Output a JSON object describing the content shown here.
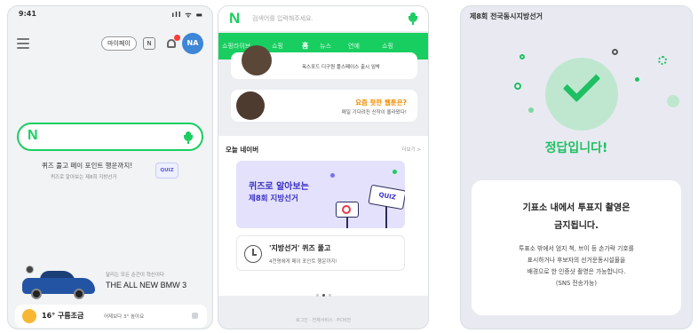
{
  "phone1": {
    "status_time": "9:41",
    "status_icons": "ıll ᯤ ▬",
    "header_pill": "마이페이",
    "header_square": "N",
    "avatar_initials": "NA",
    "search_logo": "N",
    "quiz_text": "퀴즈 풀고 페이 포인트 행운까지!",
    "quiz_subtext": "퀴즈로 알아보는 제8회 지방선거",
    "quiz_badge": "QUIZ",
    "ad_small": "달리는 모든 순간이 혁신이다",
    "ad_title": "THE ALL NEW BMW 3",
    "weather_temp": "16° 구름조금",
    "weather_sub": "어제보다 3° 높아요"
  },
  "phone2": {
    "logo": "N",
    "search_placeholder": "검색어를 입력해주세요.",
    "tabs": [
      "쇼핑라이브",
      "쇼핑",
      "홈",
      "뉴스",
      "연예",
      "쇼핑"
    ],
    "card1_text": "옥스포드 디구원 플스페이스 출시 임박",
    "card2_title": "요즘 핫한 웹툰은?",
    "card2_sub": "매일 기다려진 신작이 올라왔다!",
    "today_label": "오늘 네이버",
    "more_label": "더보기 >",
    "banner_line1": "퀴즈로 알아보는",
    "banner_line2": "제8회 지방선거",
    "banner_sign": "QUIZ",
    "quiz_item_title": "'지방선거' 퀴즈 풀고",
    "quiz_item_sub": "4천명에게 페이 포인트 행운까지!",
    "footer": "로그인 · 전체서비스 · PC버전"
  },
  "phone3": {
    "title": "제8회 전국동시지방선거",
    "correct": "정답입니다!",
    "info_title1": "기표소 내에서 투표지 촬영은",
    "info_title2": "금지됩니다.",
    "info_desc1": "투표소 밖에서 엄지 척, 브이 등 손가락 기호를",
    "info_desc2": "표시하거나 후보자의 선거운동시설물을",
    "info_desc3": "배경으로 한 인증샷 촬영은 가능합니다.",
    "info_desc4": "(SNS 전송가능)"
  },
  "colors": {
    "naver_green": "#19ce60",
    "quiz_purple": "#3b30c4",
    "success_green": "#1fbf63",
    "hot_orange": "#f08c00"
  }
}
